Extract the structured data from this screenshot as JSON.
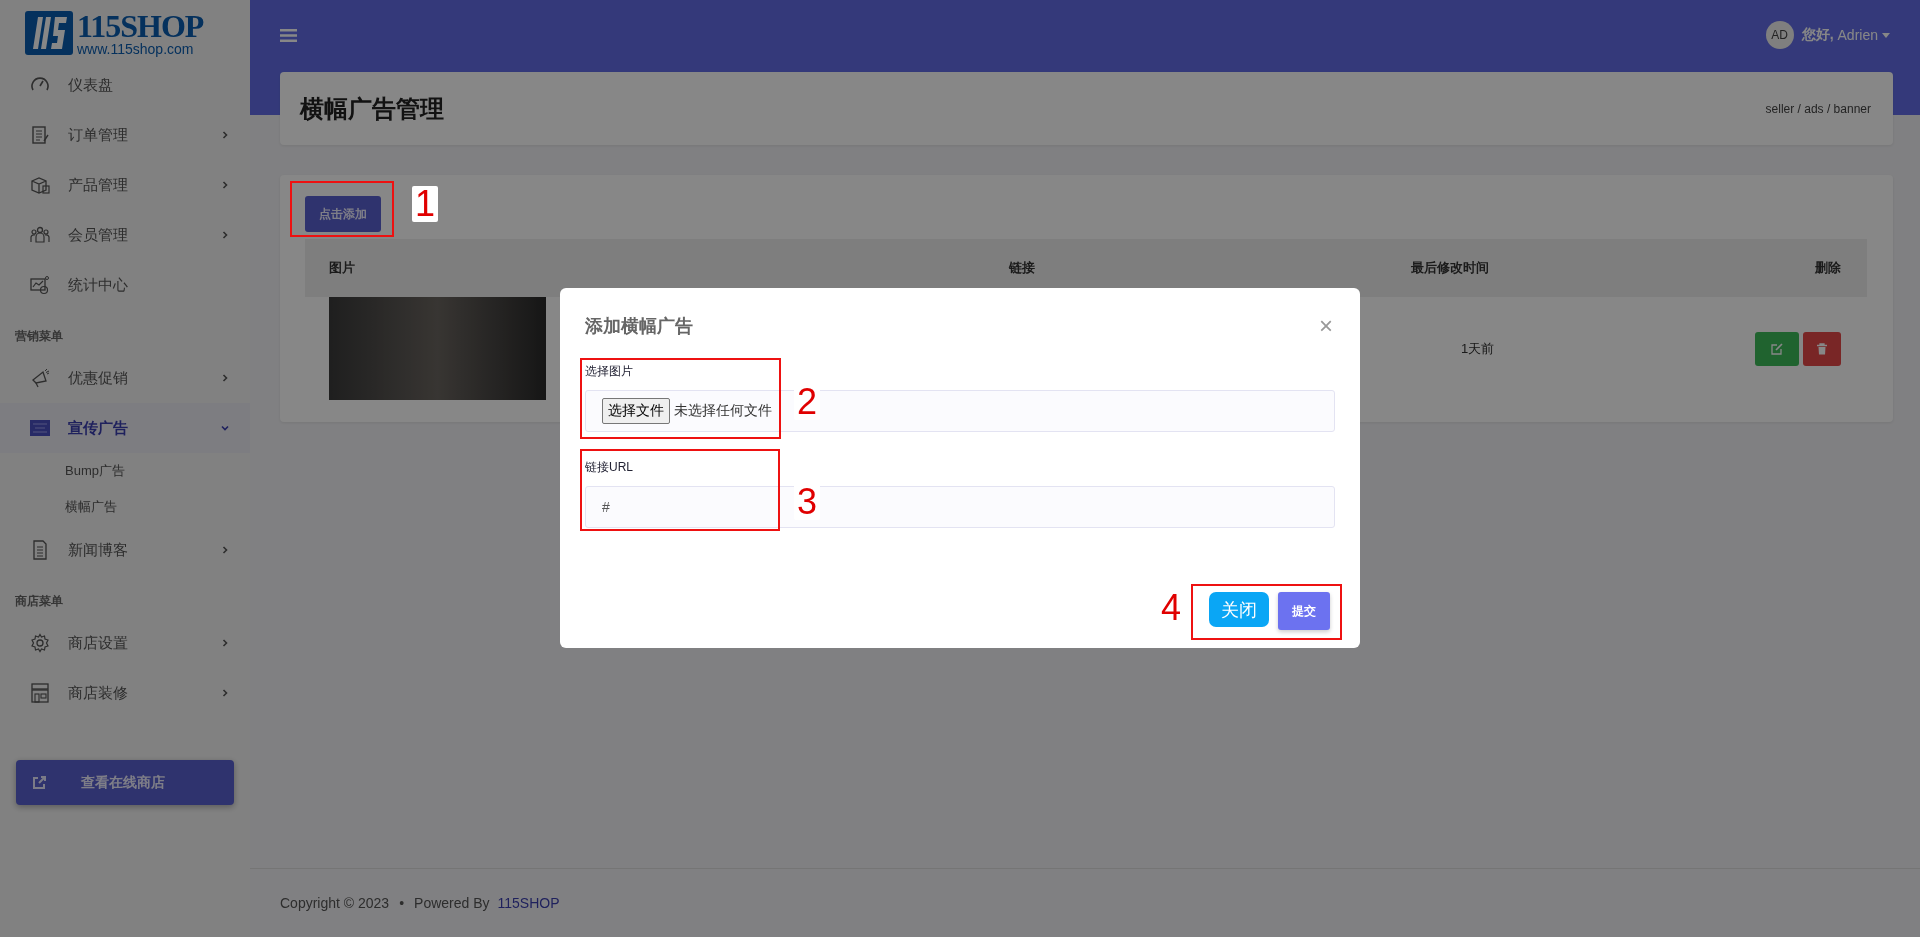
{
  "logo": {
    "title": "115SHOP",
    "url": "www.115shop.com"
  },
  "sidebar": {
    "sections": [
      {
        "items": [
          {
            "label": "仪表盘",
            "has_children": false,
            "selected": false
          },
          {
            "label": "订单管理",
            "has_children": true,
            "expanded": false,
            "selected": false
          },
          {
            "label": "产品管理",
            "has_children": true,
            "expanded": false,
            "selected": false
          },
          {
            "label": "会员管理",
            "has_children": true,
            "expanded": false,
            "selected": false
          },
          {
            "label": "统计中心",
            "has_children": false,
            "selected": false
          }
        ]
      },
      {
        "heading": "营销菜单",
        "items": [
          {
            "label": "优惠促销",
            "has_children": true,
            "expanded": false,
            "selected": false
          },
          {
            "label": "宣传广告",
            "has_children": true,
            "expanded": true,
            "selected": true,
            "children": [
              {
                "label": "Bump广告",
                "selected": false
              },
              {
                "label": "横幅广告",
                "selected": false
              }
            ]
          },
          {
            "label": "新闻博客",
            "has_children": true,
            "expanded": false,
            "selected": false
          }
        ]
      },
      {
        "heading": "商店菜单",
        "items": [
          {
            "label": "商店设置",
            "has_children": true,
            "expanded": false,
            "selected": false
          },
          {
            "label": "商店装修",
            "has_children": true,
            "expanded": false,
            "selected": false
          }
        ]
      }
    ],
    "store_button": "查看在线商店"
  },
  "topbar": {
    "avatar_initials": "AD",
    "greeting": "您好,",
    "user": "Adrien"
  },
  "page_header": {
    "title": "横幅广告管理",
    "breadcrumb": "seller / ads / banner"
  },
  "add_button": "点击添加",
  "table": {
    "columns": [
      "图片",
      "链接",
      "最后修改时间",
      "删除"
    ],
    "rows": [
      {
        "modified": "1天前"
      }
    ]
  },
  "modal": {
    "title": "添加横幅广告",
    "close": "×",
    "fields": [
      {
        "kind": "file",
        "label": "选择图片",
        "button": "选择文件",
        "status": "未选择任何文件"
      },
      {
        "kind": "text",
        "label": "链接URL",
        "value": "#"
      }
    ],
    "buttons": [
      {
        "label": "关闭",
        "kind": "secondary"
      },
      {
        "label": "提交",
        "kind": "primary"
      }
    ]
  },
  "annotations": [
    {
      "label": "1"
    },
    {
      "label": "2"
    },
    {
      "label": "3"
    },
    {
      "label": "4"
    }
  ],
  "footer": {
    "copyright": "Copyright © 2023",
    "separator": "•",
    "powered_by": "Powered By",
    "brand_link": "115SHOP"
  }
}
